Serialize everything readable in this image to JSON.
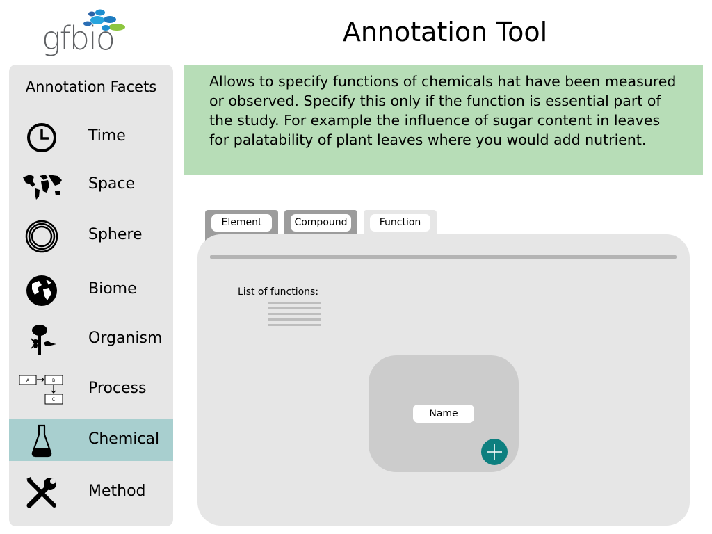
{
  "header": {
    "logo_text": "gfbio",
    "title": "Annotation Tool"
  },
  "sidebar": {
    "title": "Annotation Facets",
    "items": [
      {
        "label": "Time",
        "icon": "clock-icon"
      },
      {
        "label": "Space",
        "icon": "world-map-icon"
      },
      {
        "label": "Sphere",
        "icon": "concentric-rings-icon"
      },
      {
        "label": "Biome",
        "icon": "globe-icon"
      },
      {
        "label": "Organism",
        "icon": "tree-ant-bird-icon"
      },
      {
        "label": "Process",
        "icon": "process-flow-icon"
      },
      {
        "label": "Chemical",
        "icon": "flask-icon",
        "active": true
      },
      {
        "label": "Method",
        "icon": "wrench-screwdriver-icon"
      }
    ],
    "process_icon_labels": [
      "A",
      "B",
      "C"
    ],
    "active_color": "#a8cfcf"
  },
  "description": "Allows to specify functions of chemicals hat have been measured or observed. Specify this only if the function is essential part of the study. For example the influence of sugar content in leaves for palatability of plant leaves where you would add nutrient.",
  "tabs": [
    {
      "label": "Element"
    },
    {
      "label": "Compound"
    },
    {
      "label": "Function",
      "active": true
    }
  ],
  "panel": {
    "list_label": "List of functions:",
    "card": {
      "name_label": "Name"
    }
  },
  "colors": {
    "banner": "#b7ddb7",
    "add_button": "#0d7f7f",
    "panel": "#e6e6e6"
  }
}
